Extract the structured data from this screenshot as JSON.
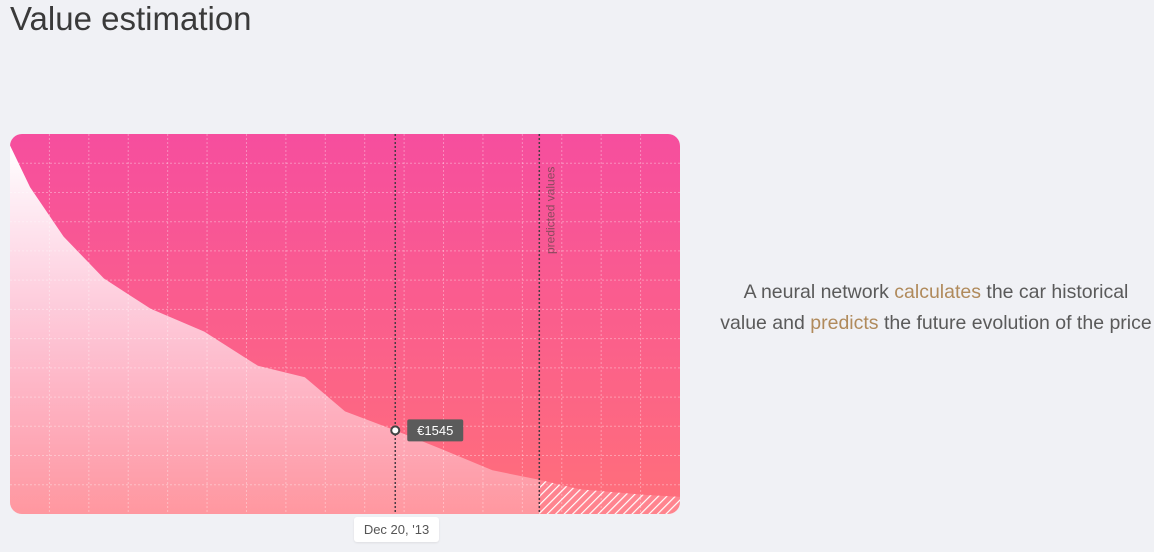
{
  "page": {
    "title": "Value estimation"
  },
  "description": {
    "part1": "A neural network ",
    "highlight1": "calculates",
    "part2": " the car historical value and ",
    "highlight2": "predicts",
    "part3": " the future evolution of the price"
  },
  "colors": {
    "gradient_top": "#f64e9e",
    "gradient_bottom": "#ff6f7a",
    "highlight": "#b08a5b",
    "tooltip_bg": "#5b5b5b"
  },
  "chart_data": {
    "type": "area",
    "title": "",
    "xlabel": "",
    "ylabel": "",
    "grid": true,
    "predicted_label": "predicted values",
    "x": [
      0,
      0.03,
      0.08,
      0.14,
      0.21,
      0.29,
      0.37,
      0.44,
      0.5,
      0.575,
      0.645,
      0.72,
      0.79,
      0.85,
      0.95,
      1.0
    ],
    "values": [
      0.97,
      0.86,
      0.73,
      0.62,
      0.54,
      0.48,
      0.39,
      0.36,
      0.27,
      0.22,
      0.17,
      0.115,
      0.09,
      0.065,
      0.05,
      0.045
    ],
    "predicted_from": 0.79,
    "selected": {
      "x": 0.575,
      "value_label": "€1545",
      "date_label": "Dec 20, '13"
    }
  }
}
